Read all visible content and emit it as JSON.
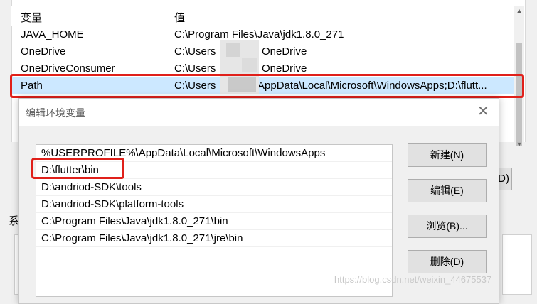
{
  "background_window": {
    "header": {
      "name": "变量",
      "value": "值"
    },
    "rows": [
      {
        "name": "JAVA_HOME",
        "value": "C:\\Program Files\\Java\\jdk1.8.0_271"
      },
      {
        "name": "OneDrive",
        "value_prefix": "C:\\Users",
        "value_suffix": "OneDrive"
      },
      {
        "name": "OneDriveConsumer",
        "value_prefix": "C:\\Users",
        "value_suffix": "OneDrive"
      },
      {
        "name": "Path",
        "value_prefix": "C:\\Users",
        "value_suffix": "AppData\\Local\\Microsoft\\WindowsApps;D:\\flutt..."
      }
    ],
    "partial_button": "D)",
    "left_label": "系",
    "scroll_up": "▲",
    "scroll_down": "▼"
  },
  "dialog": {
    "title": "编辑环境变量",
    "close_symbol": "✕",
    "paths": [
      "%USERPROFILE%\\AppData\\Local\\Microsoft\\WindowsApps",
      "D:\\flutter\\bin",
      "D:\\andriod-SDK\\tools",
      "D:\\andriod-SDK\\platform-tools",
      "C:\\Program Files\\Java\\jdk1.8.0_271\\bin",
      "C:\\Program Files\\Java\\jdk1.8.0_271\\jre\\bin"
    ],
    "buttons": {
      "new": "新建(N)",
      "edit": "编辑(E)",
      "browse": "浏览(B)...",
      "delete": "删除(D)"
    }
  },
  "watermark": "https://blog.csdn.net/weixin_44675537",
  "colors": {
    "highlight": "#e0201a",
    "selected_row": "#cce8ff"
  }
}
